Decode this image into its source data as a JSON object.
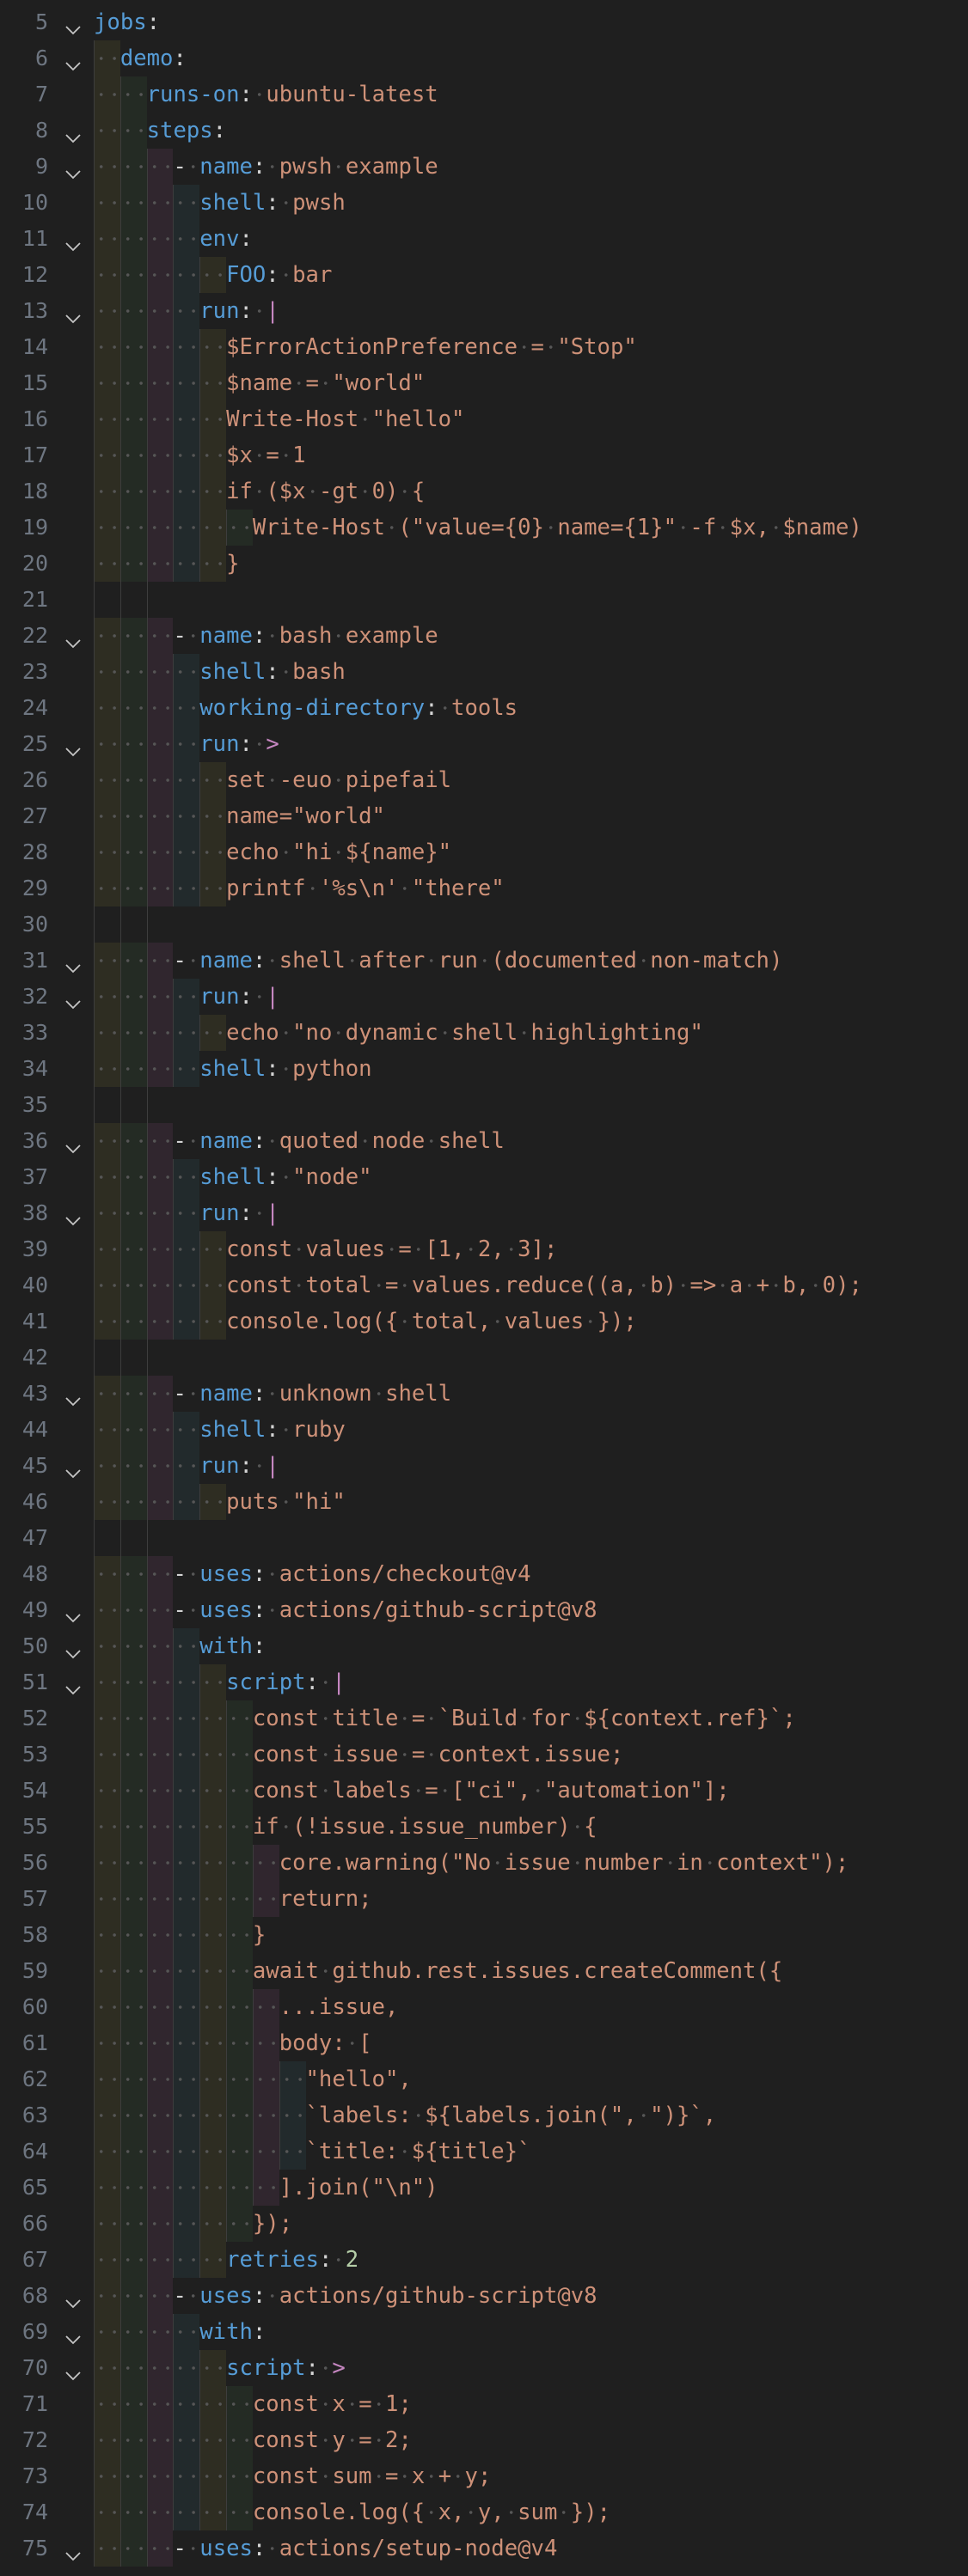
{
  "theme": {
    "background": "#1f1f1f",
    "bands": [
      "#2e2d22",
      "#242b24",
      "#30262e",
      "#222a2c"
    ],
    "colors": {
      "key": "#569cd6",
      "string": "#ce9178",
      "punct": "#d4d4d4",
      "block": "#c586c0",
      "number": "#b5cea8"
    }
  },
  "lines": [
    {
      "n": 5,
      "fold": true,
      "indent": 0,
      "tokens": [
        [
          "k",
          "jobs"
        ],
        [
          "p",
          ":"
        ]
      ]
    },
    {
      "n": 6,
      "fold": true,
      "indent": 2,
      "tokens": [
        [
          "k",
          "demo"
        ],
        [
          "p",
          ":"
        ]
      ]
    },
    {
      "n": 7,
      "fold": false,
      "indent": 4,
      "tokens": [
        [
          "k",
          "runs-on"
        ],
        [
          "p",
          ": "
        ],
        [
          "s",
          "ubuntu-latest"
        ]
      ]
    },
    {
      "n": 8,
      "fold": true,
      "indent": 4,
      "tokens": [
        [
          "k",
          "steps"
        ],
        [
          "p",
          ":"
        ]
      ]
    },
    {
      "n": 9,
      "fold": true,
      "indent": 6,
      "tokens": [
        [
          "d",
          "- "
        ],
        [
          "k",
          "name"
        ],
        [
          "p",
          ": "
        ],
        [
          "s",
          "pwsh example"
        ]
      ]
    },
    {
      "n": 10,
      "fold": false,
      "indent": 8,
      "tokens": [
        [
          "k",
          "shell"
        ],
        [
          "p",
          ": "
        ],
        [
          "s",
          "pwsh"
        ]
      ]
    },
    {
      "n": 11,
      "fold": true,
      "indent": 8,
      "tokens": [
        [
          "k",
          "env"
        ],
        [
          "p",
          ":"
        ]
      ]
    },
    {
      "n": 12,
      "fold": false,
      "indent": 10,
      "tokens": [
        [
          "k",
          "FOO"
        ],
        [
          "p",
          ": "
        ],
        [
          "s",
          "bar"
        ]
      ]
    },
    {
      "n": 13,
      "fold": true,
      "indent": 8,
      "tokens": [
        [
          "k",
          "run"
        ],
        [
          "p",
          ": "
        ],
        [
          "b",
          "|"
        ]
      ]
    },
    {
      "n": 14,
      "fold": false,
      "indent": 10,
      "tokens": [
        [
          "s",
          "$ErrorActionPreference = \"Stop\""
        ]
      ]
    },
    {
      "n": 15,
      "fold": false,
      "indent": 10,
      "tokens": [
        [
          "s",
          "$name = \"world\""
        ]
      ]
    },
    {
      "n": 16,
      "fold": false,
      "indent": 10,
      "tokens": [
        [
          "s",
          "Write-Host \"hello\""
        ]
      ]
    },
    {
      "n": 17,
      "fold": false,
      "indent": 10,
      "tokens": [
        [
          "s",
          "$x = 1"
        ]
      ]
    },
    {
      "n": 18,
      "fold": false,
      "indent": 10,
      "tokens": [
        [
          "s",
          "if ($x -gt 0) {"
        ]
      ]
    },
    {
      "n": 19,
      "fold": false,
      "indent": 12,
      "tokens": [
        [
          "s",
          "Write-Host (\"value={0} name={1}\" -f $x, $name)"
        ]
      ]
    },
    {
      "n": 20,
      "fold": false,
      "indent": 10,
      "tokens": [
        [
          "s",
          "}"
        ]
      ]
    },
    {
      "n": 21,
      "fold": false,
      "indent": 0,
      "empty": true,
      "tokens": []
    },
    {
      "n": 22,
      "fold": true,
      "indent": 6,
      "tokens": [
        [
          "d",
          "- "
        ],
        [
          "k",
          "name"
        ],
        [
          "p",
          ": "
        ],
        [
          "s",
          "bash example"
        ]
      ]
    },
    {
      "n": 23,
      "fold": false,
      "indent": 8,
      "tokens": [
        [
          "k",
          "shell"
        ],
        [
          "p",
          ": "
        ],
        [
          "s",
          "bash"
        ]
      ]
    },
    {
      "n": 24,
      "fold": false,
      "indent": 8,
      "tokens": [
        [
          "k",
          "working-directory"
        ],
        [
          "p",
          ": "
        ],
        [
          "s",
          "tools"
        ]
      ]
    },
    {
      "n": 25,
      "fold": true,
      "indent": 8,
      "tokens": [
        [
          "k",
          "run"
        ],
        [
          "p",
          ": "
        ],
        [
          "b",
          ">"
        ]
      ]
    },
    {
      "n": 26,
      "fold": false,
      "indent": 10,
      "tokens": [
        [
          "s",
          "set -euo pipefail"
        ]
      ]
    },
    {
      "n": 27,
      "fold": false,
      "indent": 10,
      "tokens": [
        [
          "s",
          "name=\"world\""
        ]
      ]
    },
    {
      "n": 28,
      "fold": false,
      "indent": 10,
      "tokens": [
        [
          "s",
          "echo \"hi ${name}\""
        ]
      ]
    },
    {
      "n": 29,
      "fold": false,
      "indent": 10,
      "tokens": [
        [
          "s",
          "printf '%s\\n' \"there\""
        ]
      ]
    },
    {
      "n": 30,
      "fold": false,
      "indent": 0,
      "empty": true,
      "tokens": []
    },
    {
      "n": 31,
      "fold": true,
      "indent": 6,
      "tokens": [
        [
          "d",
          "- "
        ],
        [
          "k",
          "name"
        ],
        [
          "p",
          ": "
        ],
        [
          "s",
          "shell after run (documented non-match)"
        ]
      ]
    },
    {
      "n": 32,
      "fold": true,
      "indent": 8,
      "tokens": [
        [
          "k",
          "run"
        ],
        [
          "p",
          ": "
        ],
        [
          "b",
          "|"
        ]
      ]
    },
    {
      "n": 33,
      "fold": false,
      "indent": 10,
      "tokens": [
        [
          "s",
          "echo \"no dynamic shell highlighting\""
        ]
      ]
    },
    {
      "n": 34,
      "fold": false,
      "indent": 8,
      "tokens": [
        [
          "k",
          "shell"
        ],
        [
          "p",
          ": "
        ],
        [
          "s",
          "python"
        ]
      ]
    },
    {
      "n": 35,
      "fold": false,
      "indent": 0,
      "empty": true,
      "tokens": []
    },
    {
      "n": 36,
      "fold": true,
      "indent": 6,
      "tokens": [
        [
          "d",
          "- "
        ],
        [
          "k",
          "name"
        ],
        [
          "p",
          ": "
        ],
        [
          "s",
          "quoted node shell"
        ]
      ]
    },
    {
      "n": 37,
      "fold": false,
      "indent": 8,
      "tokens": [
        [
          "k",
          "shell"
        ],
        [
          "p",
          ": "
        ],
        [
          "s",
          "\"node\""
        ]
      ]
    },
    {
      "n": 38,
      "fold": true,
      "indent": 8,
      "tokens": [
        [
          "k",
          "run"
        ],
        [
          "p",
          ": "
        ],
        [
          "b",
          "|"
        ]
      ]
    },
    {
      "n": 39,
      "fold": false,
      "indent": 10,
      "tokens": [
        [
          "s",
          "const values = [1, 2, 3];"
        ]
      ]
    },
    {
      "n": 40,
      "fold": false,
      "indent": 10,
      "tokens": [
        [
          "s",
          "const total = values.reduce((a, b) => a + b, 0);"
        ]
      ]
    },
    {
      "n": 41,
      "fold": false,
      "indent": 10,
      "tokens": [
        [
          "s",
          "console.log({ total, values });"
        ]
      ]
    },
    {
      "n": 42,
      "fold": false,
      "indent": 0,
      "empty": true,
      "tokens": []
    },
    {
      "n": 43,
      "fold": true,
      "indent": 6,
      "tokens": [
        [
          "d",
          "- "
        ],
        [
          "k",
          "name"
        ],
        [
          "p",
          ": "
        ],
        [
          "s",
          "unknown shell"
        ]
      ]
    },
    {
      "n": 44,
      "fold": false,
      "indent": 8,
      "tokens": [
        [
          "k",
          "shell"
        ],
        [
          "p",
          ": "
        ],
        [
          "s",
          "ruby"
        ]
      ]
    },
    {
      "n": 45,
      "fold": true,
      "indent": 8,
      "tokens": [
        [
          "k",
          "run"
        ],
        [
          "p",
          ": "
        ],
        [
          "b",
          "|"
        ]
      ]
    },
    {
      "n": 46,
      "fold": false,
      "indent": 10,
      "tokens": [
        [
          "s",
          "puts \"hi\""
        ]
      ]
    },
    {
      "n": 47,
      "fold": false,
      "indent": 0,
      "empty": true,
      "tokens": []
    },
    {
      "n": 48,
      "fold": false,
      "indent": 6,
      "tokens": [
        [
          "d",
          "- "
        ],
        [
          "k",
          "uses"
        ],
        [
          "p",
          ": "
        ],
        [
          "s",
          "actions/checkout@v4"
        ]
      ]
    },
    {
      "n": 49,
      "fold": true,
      "indent": 6,
      "tokens": [
        [
          "d",
          "- "
        ],
        [
          "k",
          "uses"
        ],
        [
          "p",
          ": "
        ],
        [
          "s",
          "actions/github-script@v8"
        ]
      ]
    },
    {
      "n": 50,
      "fold": true,
      "indent": 8,
      "tokens": [
        [
          "k",
          "with"
        ],
        [
          "p",
          ":"
        ]
      ]
    },
    {
      "n": 51,
      "fold": true,
      "indent": 10,
      "tokens": [
        [
          "k",
          "script"
        ],
        [
          "p",
          ": "
        ],
        [
          "b",
          "|"
        ]
      ]
    },
    {
      "n": 52,
      "fold": false,
      "indent": 12,
      "tokens": [
        [
          "s",
          "const title = `Build for ${context.ref}`;"
        ]
      ]
    },
    {
      "n": 53,
      "fold": false,
      "indent": 12,
      "tokens": [
        [
          "s",
          "const issue = context.issue;"
        ]
      ]
    },
    {
      "n": 54,
      "fold": false,
      "indent": 12,
      "tokens": [
        [
          "s",
          "const labels = [\"ci\", \"automation\"];"
        ]
      ]
    },
    {
      "n": 55,
      "fold": false,
      "indent": 12,
      "tokens": [
        [
          "s",
          "if (!issue.issue_number) {"
        ]
      ]
    },
    {
      "n": 56,
      "fold": false,
      "indent": 14,
      "tokens": [
        [
          "s",
          "core.warning(\"No issue number in context\");"
        ]
      ]
    },
    {
      "n": 57,
      "fold": false,
      "indent": 14,
      "tokens": [
        [
          "s",
          "return;"
        ]
      ]
    },
    {
      "n": 58,
      "fold": false,
      "indent": 12,
      "tokens": [
        [
          "s",
          "}"
        ]
      ]
    },
    {
      "n": 59,
      "fold": false,
      "indent": 12,
      "tokens": [
        [
          "s",
          "await github.rest.issues.createComment({"
        ]
      ]
    },
    {
      "n": 60,
      "fold": false,
      "indent": 14,
      "tokens": [
        [
          "s",
          "...issue,"
        ]
      ]
    },
    {
      "n": 61,
      "fold": false,
      "indent": 14,
      "tokens": [
        [
          "s",
          "body: ["
        ]
      ]
    },
    {
      "n": 62,
      "fold": false,
      "indent": 16,
      "tokens": [
        [
          "s",
          "\"hello\","
        ]
      ]
    },
    {
      "n": 63,
      "fold": false,
      "indent": 16,
      "tokens": [
        [
          "s",
          "`labels: ${labels.join(\", \")}`,"
        ]
      ]
    },
    {
      "n": 64,
      "fold": false,
      "indent": 16,
      "tokens": [
        [
          "s",
          "`title: ${title}`"
        ]
      ]
    },
    {
      "n": 65,
      "fold": false,
      "indent": 14,
      "tokens": [
        [
          "s",
          "].join(\"\\n\")"
        ]
      ]
    },
    {
      "n": 66,
      "fold": false,
      "indent": 12,
      "tokens": [
        [
          "s",
          "});"
        ]
      ]
    },
    {
      "n": 67,
      "fold": false,
      "indent": 10,
      "tokens": [
        [
          "k",
          "retries"
        ],
        [
          "p",
          ": "
        ],
        [
          "n",
          "2"
        ]
      ]
    },
    {
      "n": 68,
      "fold": true,
      "indent": 6,
      "tokens": [
        [
          "d",
          "- "
        ],
        [
          "k",
          "uses"
        ],
        [
          "p",
          ": "
        ],
        [
          "s",
          "actions/github-script@v8"
        ]
      ]
    },
    {
      "n": 69,
      "fold": true,
      "indent": 8,
      "tokens": [
        [
          "k",
          "with"
        ],
        [
          "p",
          ":"
        ]
      ]
    },
    {
      "n": 70,
      "fold": true,
      "indent": 10,
      "tokens": [
        [
          "k",
          "script"
        ],
        [
          "p",
          ": "
        ],
        [
          "b",
          ">"
        ]
      ]
    },
    {
      "n": 71,
      "fold": false,
      "indent": 12,
      "tokens": [
        [
          "s",
          "const x = 1;"
        ]
      ]
    },
    {
      "n": 72,
      "fold": false,
      "indent": 12,
      "tokens": [
        [
          "s",
          "const y = 2;"
        ]
      ]
    },
    {
      "n": 73,
      "fold": false,
      "indent": 12,
      "tokens": [
        [
          "s",
          "const sum = x + y;"
        ]
      ]
    },
    {
      "n": 74,
      "fold": false,
      "indent": 12,
      "tokens": [
        [
          "s",
          "console.log({ x, y, sum });"
        ]
      ]
    },
    {
      "n": 75,
      "fold": true,
      "indent": 6,
      "tokens": [
        [
          "d",
          "- "
        ],
        [
          "k",
          "uses"
        ],
        [
          "p",
          ": "
        ],
        [
          "s",
          "actions/setup-node@v4"
        ]
      ]
    }
  ]
}
